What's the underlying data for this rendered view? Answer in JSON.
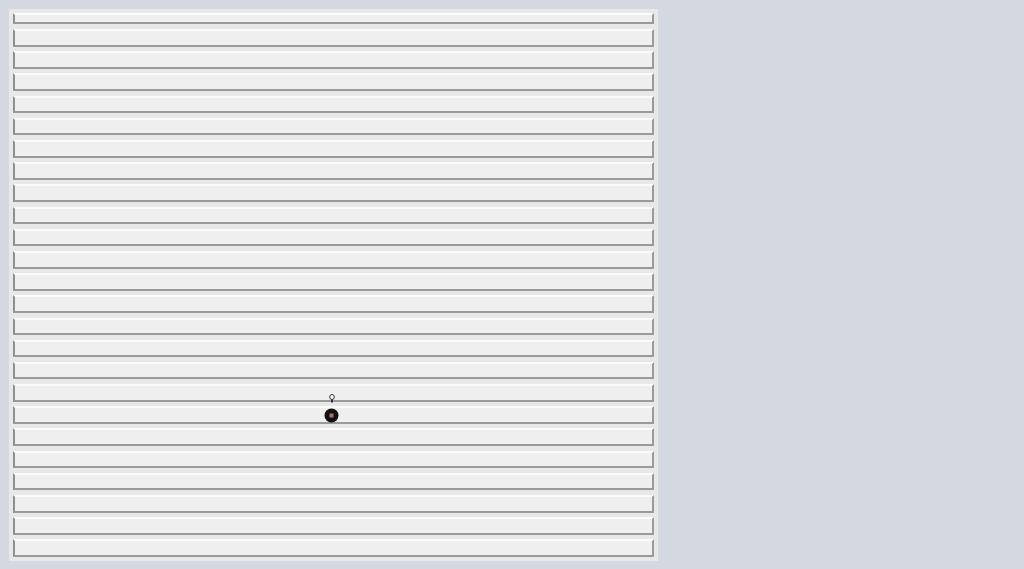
{
  "slats": [
    {
      "kind": "partial"
    },
    {
      "kind": "full"
    },
    {
      "kind": "full"
    },
    {
      "kind": "full"
    },
    {
      "kind": "full"
    },
    {
      "kind": "full"
    },
    {
      "kind": "full"
    },
    {
      "kind": "full"
    },
    {
      "kind": "full"
    },
    {
      "kind": "full"
    },
    {
      "kind": "full"
    },
    {
      "kind": "full"
    },
    {
      "kind": "full"
    },
    {
      "kind": "full"
    },
    {
      "kind": "full"
    },
    {
      "kind": "full"
    },
    {
      "kind": "full"
    },
    {
      "kind": "full"
    },
    {
      "kind": "full"
    },
    {
      "kind": "full"
    },
    {
      "kind": "full"
    },
    {
      "kind": "full"
    },
    {
      "kind": "full"
    },
    {
      "kind": "full"
    },
    {
      "kind": "full"
    }
  ],
  "markers": [
    {
      "kind": "pin"
    },
    {
      "kind": "dot"
    }
  ]
}
